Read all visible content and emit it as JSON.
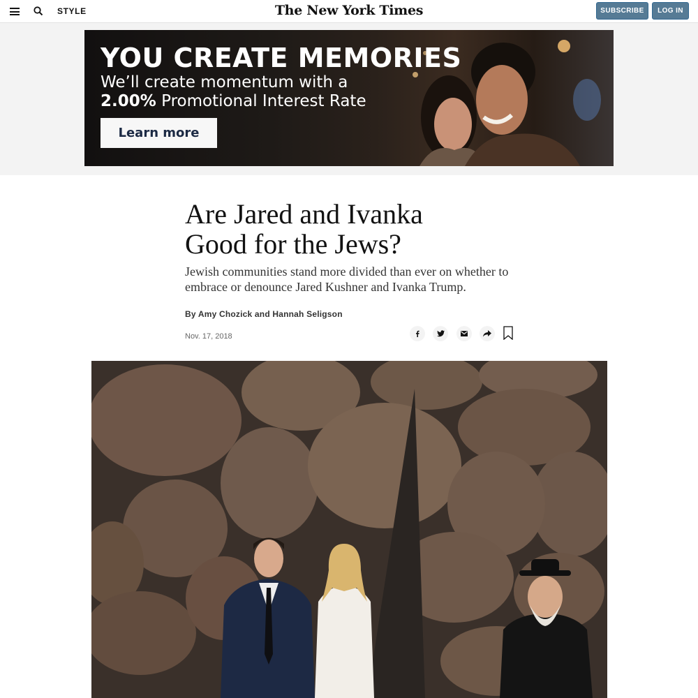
{
  "header": {
    "menu_icon": "hamburger-menu-icon",
    "search_icon": "search-icon",
    "section": "STYLE",
    "masthead": "The New York Times",
    "subscribe_label": "SUBSCRIBE",
    "login_label": "LOG IN",
    "button_color": "#567b95"
  },
  "ad": {
    "headline": "YOU CREATE MEMORIES",
    "line2": "We’ll create momentum with a",
    "rate": "2.00%",
    "line3_rest": " Promotional Interest Rate",
    "cta_label": "Learn more"
  },
  "article": {
    "headline_line1": "Are Jared and Ivanka",
    "headline_line2": "Good for the Jews?",
    "summary": "Jewish communities stand more divided than ever on whether to embrace or denounce Jared Kushner and Ivanka Trump.",
    "byline": "By Amy Chozick and Hannah Seligson",
    "date": "Nov. 17, 2018"
  },
  "share": {
    "facebook_icon": "facebook-icon",
    "twitter_icon": "twitter-icon",
    "email_icon": "email-icon",
    "more_icon": "share-arrow-icon",
    "bookmark_icon": "bookmark-icon"
  }
}
